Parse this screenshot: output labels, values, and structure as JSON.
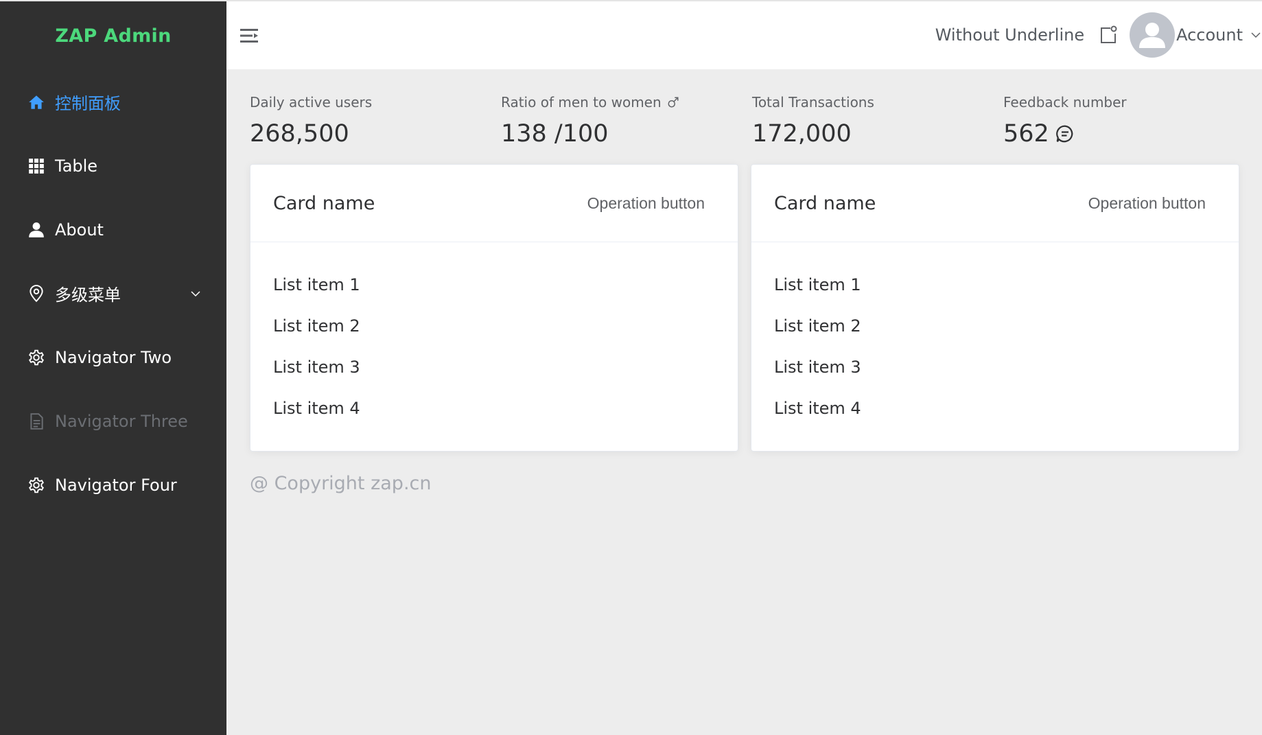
{
  "sidebar": {
    "logo": "ZAP Admin",
    "items": [
      {
        "label": "控制面板",
        "icon": "home-icon",
        "state": "active"
      },
      {
        "label": "Table",
        "icon": "grid-icon",
        "state": "normal"
      },
      {
        "label": "About",
        "icon": "user-icon",
        "state": "normal"
      },
      {
        "label": "多级菜单",
        "icon": "location-icon",
        "state": "normal",
        "has_submenu": true
      },
      {
        "label": "Navigator Two",
        "icon": "gear-icon",
        "state": "normal"
      },
      {
        "label": "Navigator Three",
        "icon": "document-icon",
        "state": "disabled"
      },
      {
        "label": "Navigator Four",
        "icon": "gear-icon",
        "state": "normal"
      }
    ]
  },
  "header": {
    "link": "Without Underline",
    "account": "Account"
  },
  "stats": [
    {
      "title": "Daily active users",
      "value": "268,500"
    },
    {
      "title": "Ratio of men to women",
      "value": "138 /100",
      "title_icon": "male-icon"
    },
    {
      "title": "Total Transactions",
      "value": "172,000"
    },
    {
      "title": "Feedback number",
      "value": "562",
      "value_icon": "chat-bubble-icon"
    }
  ],
  "cards": [
    {
      "title": "Card name",
      "operation": "Operation button",
      "items": [
        "List item 1",
        "List item 2",
        "List item 3",
        "List item 4"
      ]
    },
    {
      "title": "Card name",
      "operation": "Operation button",
      "items": [
        "List item 1",
        "List item 2",
        "List item 3",
        "List item 4"
      ]
    }
  ],
  "footer": {
    "copyright": "@ Copyright zap.cn"
  },
  "colors": {
    "sidebar_bg": "#303030",
    "logo": "#4cd87c",
    "active": "#409eff",
    "disabled": "#6b6e73",
    "page_bg": "#ededed"
  }
}
